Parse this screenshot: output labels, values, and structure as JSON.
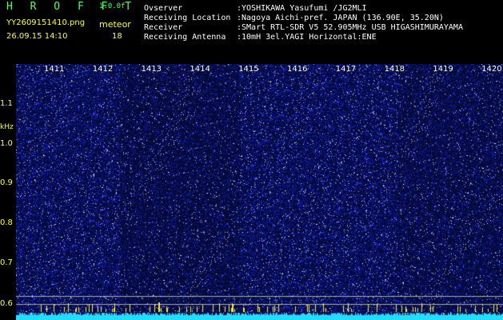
{
  "header": {
    "app_title": "H R O F F T",
    "app_version": "1.0.0f",
    "filename": "YY2609151410.png",
    "mode_label": "meteor",
    "datetime": "26.09.15 14:10",
    "count_value": "18",
    "info": [
      {
        "label": "Ovserver",
        "value": ":YOSHIKAWA Yasufumi /JG2MLI"
      },
      {
        "label": "Receiving Location",
        "value": ":Nagoya Aichi-pref. JAPAN (136.90E, 35.20N)"
      },
      {
        "label": "Receiver",
        "value": ":SMart RTL-SDR V5 52.905MHz USB HIGASHIMURAYAMA"
      },
      {
        "label": "Receiving Antenna",
        "value": ":10mH 3el.YAGI Horizontal:ENE"
      }
    ]
  },
  "chart_data": {
    "type": "heatmap",
    "title": "",
    "ylabel": "kHz",
    "y_ticks": [
      "1.1",
      "1.0",
      "0.9",
      "0.8",
      "0.7",
      "0.6"
    ],
    "x_ticks": [
      "1411",
      "1412",
      "1413",
      "1414",
      "1415",
      "1416",
      "1417",
      "1418",
      "1419",
      "1420"
    ],
    "colors": {
      "background": "#06124a",
      "noise": "#2a3fd0",
      "bright": "#ffffff",
      "cyan_band": "#22ddff",
      "tick_color": "#ffff33"
    }
  }
}
